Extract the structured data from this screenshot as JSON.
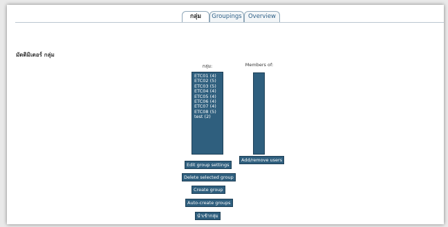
{
  "tabs": [
    {
      "label": "กลุ่ม",
      "active": true
    },
    {
      "label": "Groupings",
      "active": false
    },
    {
      "label": "Overview",
      "active": false
    }
  ],
  "heading": "มัดดิมิเตอร์ กลุ่ม",
  "groups_column": {
    "label": "กลุ่ม:",
    "items": [
      "ETC01 (4)",
      "ETC02 (5)",
      "ETC03 (5)",
      "ETC04 (4)",
      "ETC05 (4)",
      "ETC06 (4)",
      "ETC07 (4)",
      "ETC08 (5)",
      "test (2)"
    ]
  },
  "members_column": {
    "label": "Members of:",
    "items": []
  },
  "buttons": {
    "edit_group_settings": "Edit group settings",
    "delete_selected_group": "Delete selected group",
    "create_group": "Create group",
    "auto_create_groups": "Auto-create groups",
    "import_groups": "นำเข้ากลุ่ม",
    "add_remove_users": "Add/remove users"
  },
  "colors": {
    "listbox_bg": "#2f5f7e",
    "button_bg": "#2f5f7e",
    "tab_text": "#2d5f87"
  }
}
